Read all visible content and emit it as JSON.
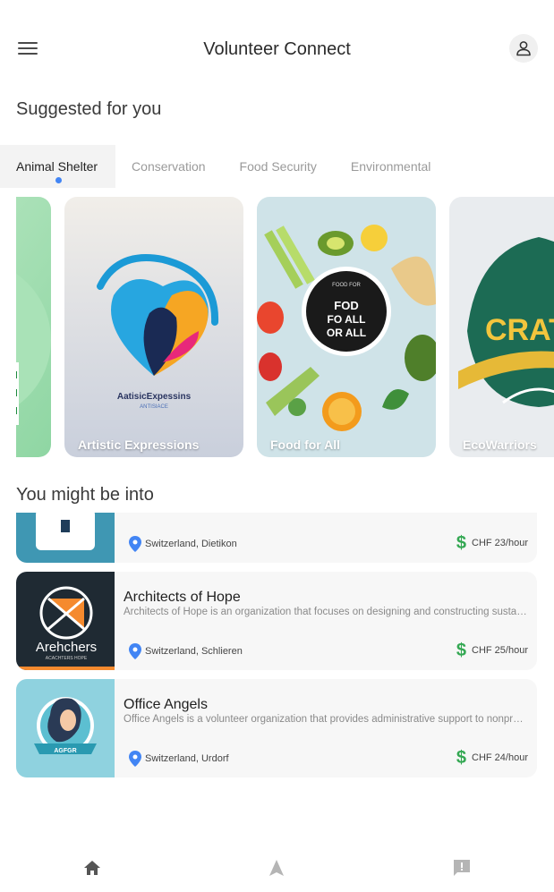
{
  "header": {
    "title": "Volunteer Connect"
  },
  "sections": {
    "suggested": "Suggested for you",
    "might_like": "You might be into"
  },
  "tabs": [
    {
      "label": "Animal Shelter",
      "active": true
    },
    {
      "label": "Conservation",
      "active": false
    },
    {
      "label": "Food Security",
      "active": false
    },
    {
      "label": "Environmental",
      "active": false
    }
  ],
  "cards": [
    {
      "label": ""
    },
    {
      "label": "Artistic Expressions",
      "art_text": "AatisicExpessins",
      "art_sub": "ANTISIACE"
    },
    {
      "label": "Food for All",
      "art_text": [
        "FOD",
        "FO ALL",
        "OR ALL"
      ],
      "art_top": "FOOD FOR"
    },
    {
      "label": "EcoWarriors",
      "art_text": "CRAT"
    }
  ],
  "opportunities": [
    {
      "title": "",
      "description": "",
      "location": "Switzerland, Dietikon",
      "rate": "CHF 23/hour",
      "thumb_text": ""
    },
    {
      "title": "Architects of Hope",
      "description": "Architects of Hope is an organization that focuses on designing and constructing sustainable homes for communities in need.",
      "location": "Switzerland, Schlieren",
      "rate": "CHF 25/hour",
      "thumb_text": "Arehchers",
      "thumb_sub": "ACACHTERS HOPE"
    },
    {
      "title": "Office Angels",
      "description": "Office Angels is a volunteer organization that provides administrative support to nonprofit organizations.",
      "location": "Switzerland, Urdorf",
      "rate": "CHF 24/hour",
      "thumb_text": "AGFGR"
    }
  ],
  "colors": {
    "accent": "#4285f4",
    "rate_icon": "#34a853",
    "location_pin": "#4285f4"
  },
  "nav": [
    {
      "icon": "home-icon"
    },
    {
      "icon": "navigation-icon"
    },
    {
      "icon": "feedback-icon"
    }
  ]
}
